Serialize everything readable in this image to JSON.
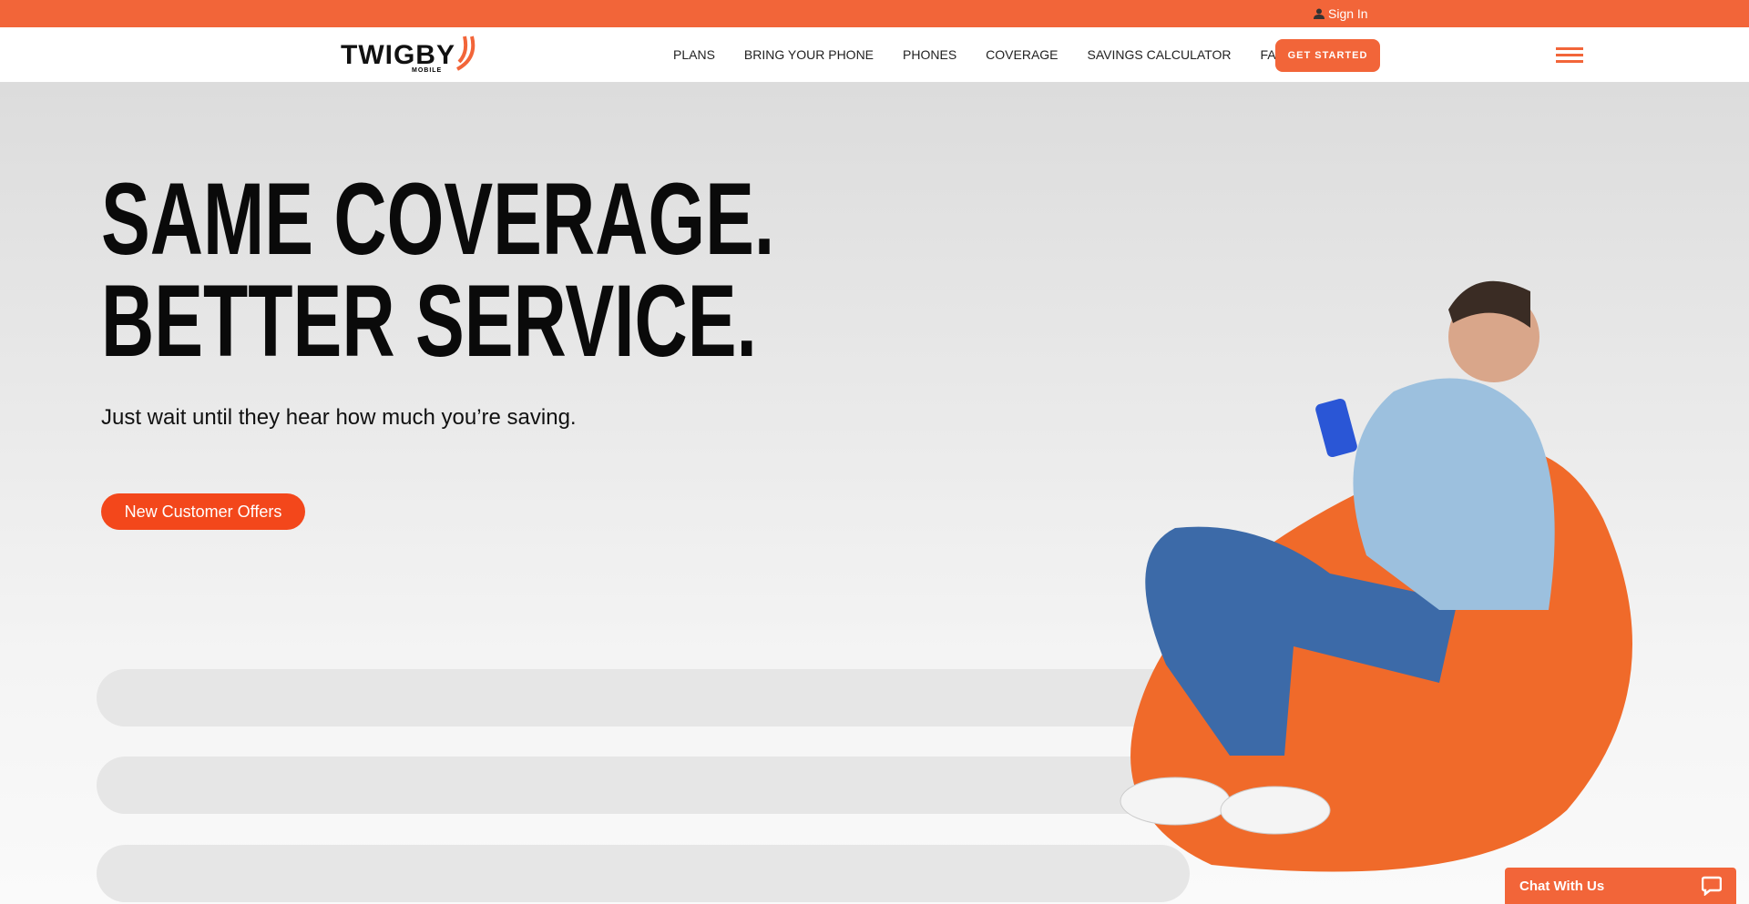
{
  "topbar": {
    "signin": "Sign In"
  },
  "nav": {
    "logo": "TWIGBY",
    "logo_sub": "MOBILE",
    "links": [
      "PLANS",
      "BRING YOUR PHONE",
      "PHONES",
      "COVERAGE",
      "SAVINGS CALCULATOR",
      "FAQS"
    ],
    "cta": "GET STARTED"
  },
  "hero": {
    "line1": "SAME COVERAGE.",
    "line2": "BETTER SERVICE.",
    "subtitle": "Just wait until they hear how much you’re saving.",
    "button": "New Customer Offers"
  },
  "chat": {
    "label": "Chat With Us"
  },
  "colors": {
    "accent": "#f26539",
    "button": "#f3471b"
  }
}
